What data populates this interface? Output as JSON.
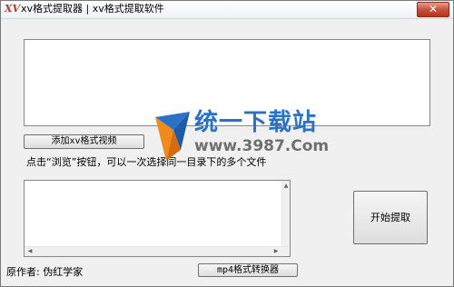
{
  "window": {
    "icon_text": "XV",
    "title": "xv格式提取器 | xv格式提取软件",
    "close_symbol": "✕"
  },
  "buttons": {
    "add_label": "添加xv格式视频",
    "start_label": "开始提取",
    "mp4_label": "mp4格式转换器"
  },
  "hint_text": "点击“浏览”按钮，可以一次选择同一目录下的多个文件",
  "author_text": "原作者: 伪红学家",
  "watermark": {
    "logo_text": "统一下载站",
    "url_text": "www.3987.Com",
    "colors": {
      "blue": "#2a72c8",
      "orange": "#f08a1c",
      "gray": "#6f6f6f"
    }
  },
  "scrollbar": {
    "up": "▲",
    "down": "▼",
    "left": "◀",
    "right": "▶"
  }
}
